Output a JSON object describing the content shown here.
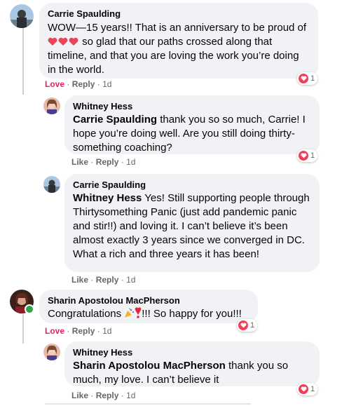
{
  "comments": [
    {
      "author": "Carrie Spaulding",
      "text_pre": "WOW—15 years!! That is an anniversary to be proud of",
      "text_post": "so glad that our paths crossed along that timeline, and that you are loving the work you’re doing in the world.",
      "actions": {
        "like": "Love",
        "reply": "Reply",
        "time": "1d"
      },
      "reaction_count": "1"
    },
    {
      "author": "Whitney Hess",
      "mention": "Carrie Spaulding",
      "text": "thank you so so much, Carrie! I hope you’re doing well. Are you still doing thirty-something coaching?",
      "actions": {
        "like": "Like",
        "reply": "Reply",
        "time": "1d"
      },
      "reaction_count": "1"
    },
    {
      "author": "Carrie Spaulding",
      "mention": "Whitney Hess",
      "text": "Yes! Still supporting people through Thirtysomething Panic (just add pandemic panic and stir!!) and loving it. I can’t believe it’s been almost exactly 3 years since we converged in DC. What a rich and three years it has been!",
      "actions": {
        "like": "Like",
        "reply": "Reply",
        "time": "1d"
      }
    },
    {
      "author": "Sharin Apostolou MacPherson",
      "text_pre": "Congratulations",
      "text_post": "!!! So happy for you!!!",
      "actions": {
        "like": "Love",
        "reply": "Reply",
        "time": "1d"
      },
      "reaction_count": "1"
    },
    {
      "author": "Whitney Hess",
      "mention": "Sharin Apostolou MacPherson",
      "text": "thank you so much, my love. I can’t believe it",
      "actions": {
        "like": "Like",
        "reply": "Reply",
        "time": "1d"
      },
      "reaction_count": "1"
    }
  ],
  "colors": {
    "love": "#e0245e",
    "heart_reaction": "#f33e58",
    "bubble": "#f0f2f5",
    "meta": "#65676b",
    "online": "#31a24c"
  },
  "icons": [
    "heart-reaction-icon",
    "heart-emoji-icon",
    "party-popper-icon",
    "exclamation-emoji-icon",
    "online-status-icon"
  ]
}
